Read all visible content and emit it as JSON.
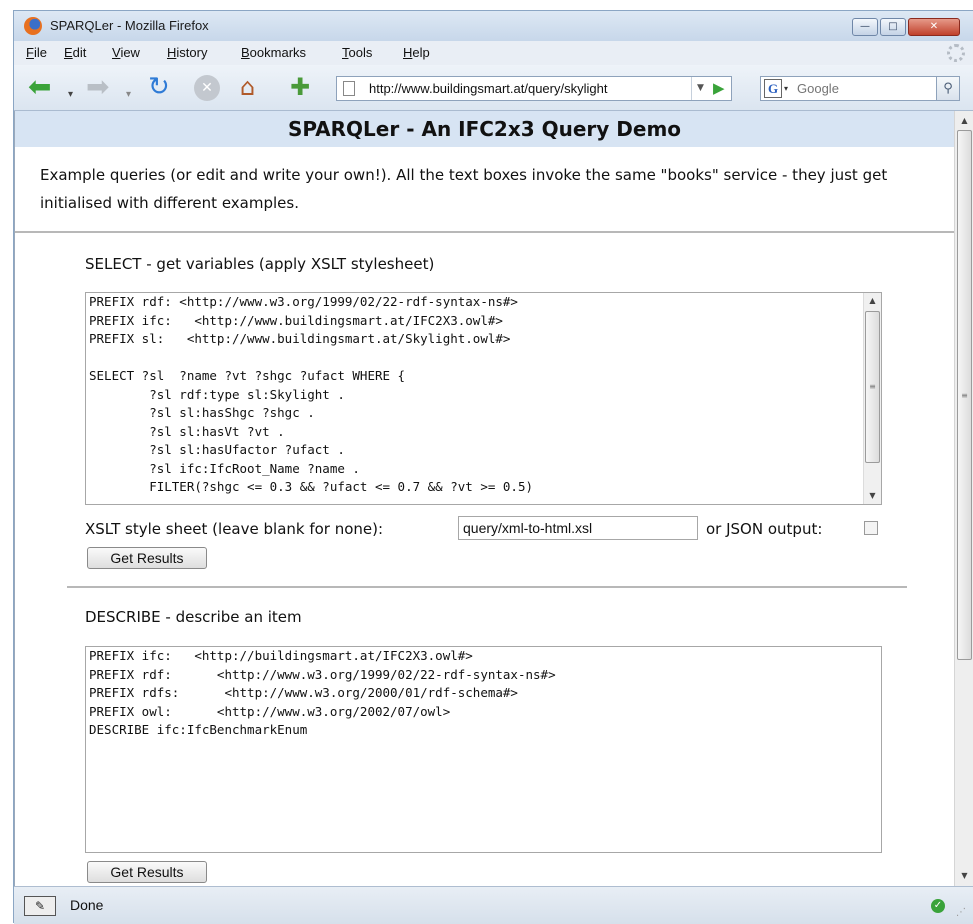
{
  "window": {
    "title": "SPARQLer - Mozilla Firefox",
    "minimize": "—",
    "maximize": "□",
    "close": "✕"
  },
  "menubar": {
    "items": [
      "File",
      "Edit",
      "View",
      "History",
      "Bookmarks",
      "Tools",
      "Help"
    ]
  },
  "toolbar": {
    "back": "⬅",
    "forward": "➡",
    "dropdown": "▾",
    "reload": "↻",
    "stop": "✕",
    "home": "⌂",
    "new_tab": "✚",
    "url": "http://www.buildingsmart.at/query/skylight",
    "url_dropdown": "▼",
    "go": "▶",
    "search_engine": "G",
    "search_placeholder": "Google",
    "search_button": "⚲"
  },
  "page": {
    "heading": "SPARQLer - An IFC2x3 Query Demo",
    "intro": "Example queries (or edit and write your own!). All the text boxes invoke the same \"books\" service - they just get initialised with different examples."
  },
  "select_section": {
    "title": "SELECT - get variables (apply XSLT stylesheet)",
    "query_lines": [
      "PREFIX rdf: <http://www.w3.org/1999/02/22-rdf-syntax-ns#>",
      "PREFIX ifc:   <http://www.buildingsmart.at/IFC2X3.owl#>",
      "PREFIX sl:   <http://www.buildingsmart.at/Skylight.owl#>",
      "",
      "SELECT ?sl  ?name ?vt ?shgc ?ufact WHERE {",
      "        ?sl rdf:type sl:Skylight .",
      "        ?sl sl:hasShgc ?shgc .",
      "        ?sl sl:hasVt ?vt .",
      "        ?sl sl:hasUfactor ?ufact .",
      "        ?sl ifc:IfcRoot_Name ?name .",
      "        FILTER(?shgc <= 0.3 && ?ufact <= 0.7 && ?vt >= 0.5)"
    ],
    "xslt_label": "XSLT style sheet (leave blank for none):",
    "xslt_value": "query/xml-to-html.xsl",
    "json_label": "or JSON output:",
    "json_checked": false,
    "button": "Get Results"
  },
  "describe_section": {
    "title": "DESCRIBE - describe an item",
    "query_lines": [
      "PREFIX ifc:   <http://buildingsmart.at/IFC2X3.owl#>",
      "PREFIX rdf:      <http://www.w3.org/1999/02/22-rdf-syntax-ns#>",
      "PREFIX rdfs:      <http://www.w3.org/2000/01/rdf-schema#>",
      "PREFIX owl:      <http://www.w3.org/2002/07/owl>",
      "DESCRIBE ifc:IfcBenchmarkEnum"
    ],
    "button": "Get Results"
  },
  "scroll": {
    "up": "▲",
    "down": "▼",
    "grip": "≡"
  },
  "statusbar": {
    "icon": "✎",
    "text": "Done",
    "ok": "✓",
    "resize": "⋰"
  },
  "colors": {
    "header_bg": "#d7e4f3",
    "window_frame": "#8ba6c4",
    "back_arrow": "#3aa33a",
    "reload": "#2f7bd6"
  }
}
